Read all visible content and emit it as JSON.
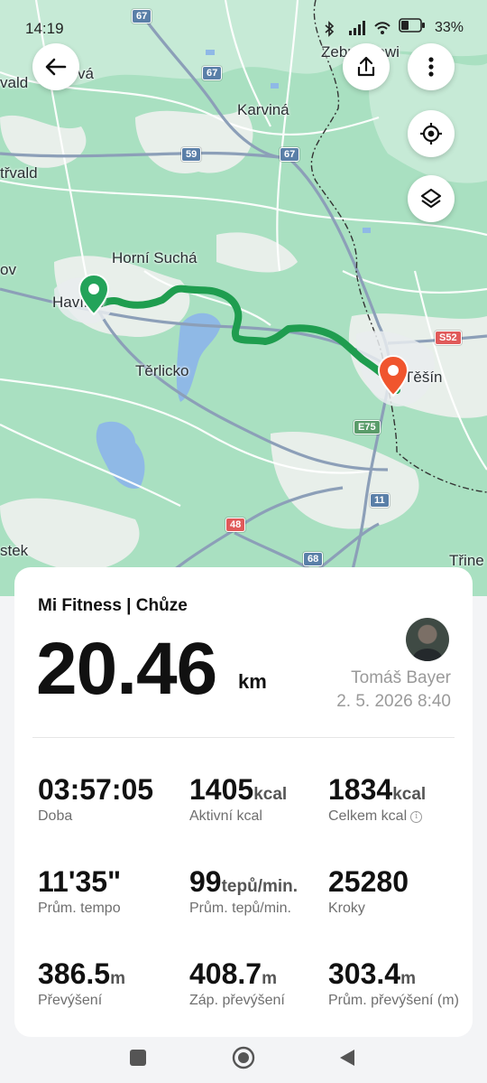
{
  "status_bar": {
    "time": "14:19",
    "battery": "33%"
  },
  "map": {
    "labels": {
      "top_partial": "Zebrzydowi",
      "karvina": "Karviná",
      "horni_sucha": "Horní Suchá",
      "havirov": "Havířov",
      "terlicko": "Těrlicko",
      "cesin": "Těšín",
      "trinec": "Třine",
      "left_vald": "vald",
      "left_trvald": "třvald",
      "left_ov": "ov",
      "left_stek": "stek",
      "top_va": "vá"
    },
    "road_shields": {
      "r67_top": "67",
      "r67_mid": "67",
      "r67_east": "67",
      "r59": "59",
      "s52": "S52",
      "e75": "E75",
      "r11": "11",
      "r48": "48",
      "r68": "68"
    },
    "route_color": "#1f9d4f",
    "start_marker_color": "#23a35a",
    "end_marker_color": "#f0552e"
  },
  "toolbar": {
    "back_icon": "arrow-left-icon",
    "share_icon": "share-icon",
    "more_icon": "more-vertical-icon",
    "locate_icon": "locate-icon",
    "layers_icon": "layers-icon"
  },
  "activity": {
    "source": "Mi Fitness | Chůze",
    "distance": "20.46",
    "distance_unit": "km",
    "user_name": "Tomáš Bayer",
    "date": "2. 5. 2026 8:40"
  },
  "stats": [
    {
      "value": "03:57:05",
      "unit": "",
      "label": "Doba"
    },
    {
      "value": "1405",
      "unit": "kcal",
      "label": "Aktivní kcal"
    },
    {
      "value": "1834",
      "unit": "kcal",
      "label": "Celkem kcal"
    },
    {
      "value": "11'35\"",
      "unit": "",
      "label": "Prům. tempo"
    },
    {
      "value": "99",
      "unit": "tepů/min.",
      "label": "Prům. tepů/min."
    },
    {
      "value": "25280",
      "unit": "",
      "label": "Kroky"
    },
    {
      "value": "386.5",
      "unit": "m",
      "label": "Převýšení"
    },
    {
      "value": "408.7",
      "unit": "m",
      "label": "Záp. převýšení"
    },
    {
      "value": "303.4",
      "unit": "m",
      "label": "Prům. převýšení (m)"
    }
  ]
}
